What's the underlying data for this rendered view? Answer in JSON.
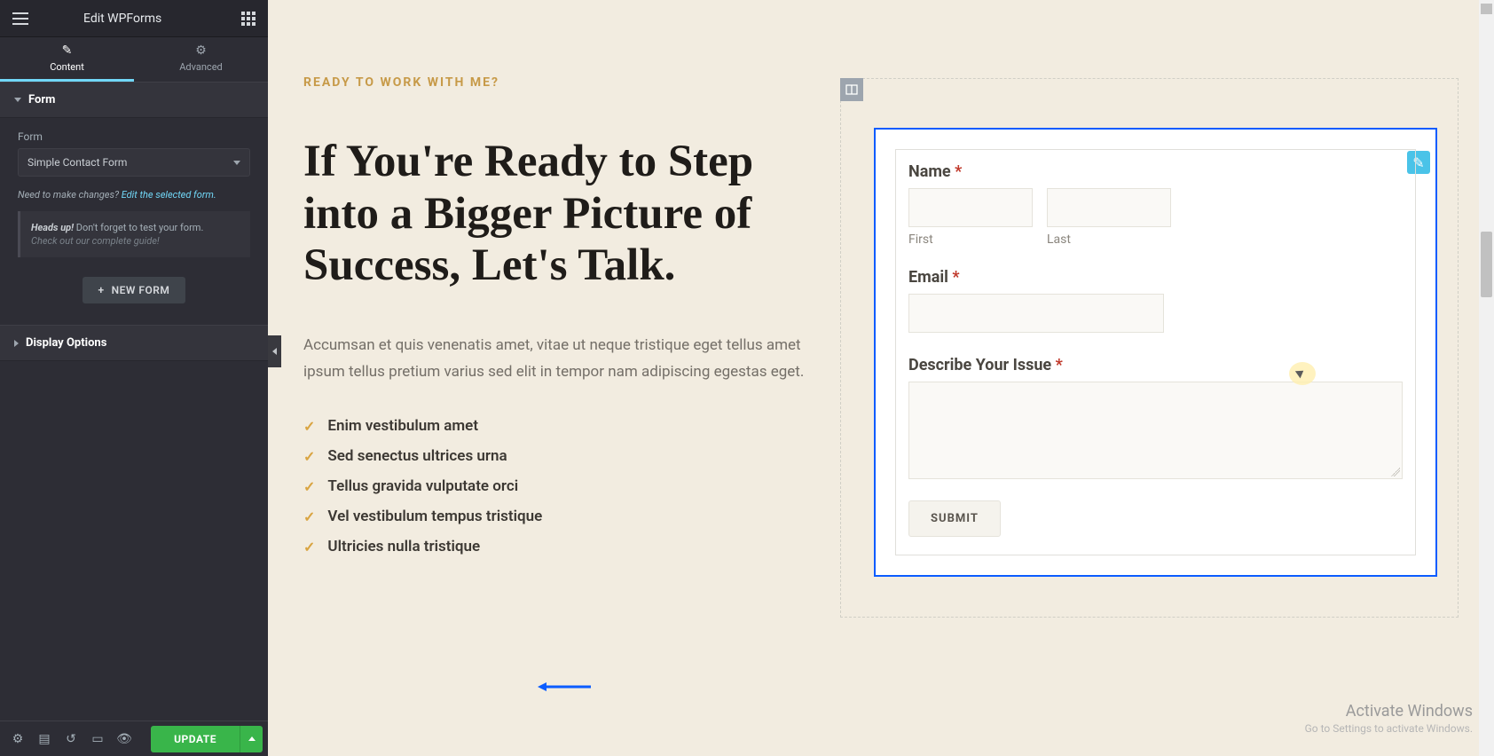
{
  "panel": {
    "title": "Edit WPForms",
    "tabs": {
      "content": "Content",
      "advanced": "Advanced"
    },
    "section_form_label": "Form",
    "form_field_label": "Form",
    "form_select_value": "Simple Contact Form",
    "hint_prefix": "Need to make changes? ",
    "hint_link": "Edit the selected form.",
    "heads_up_strong": "Heads up!",
    "heads_up_rest": " Don't forget to test your form.",
    "heads_up_sub": "Check out our complete guide!",
    "new_form_label": "NEW FORM",
    "section_display_label": "Display Options",
    "update_label": "UPDATE"
  },
  "page": {
    "eyebrow": "READY TO WORK WITH ME?",
    "heading": "If You're Ready to Step into a Bigger Picture of Success, Let's Talk.",
    "paragraph": "Accumsan et quis venenatis amet, vitae ut neque tristique eget tellus amet ipsum tellus pretium varius sed elit in tempor nam adipiscing egestas eget.",
    "list": [
      "Enim vestibulum amet",
      "Sed senectus ultrices urna",
      "Tellus gravida vulputate orci",
      "Vel vestibulum tempus tristique",
      "Ultricies nulla tristique"
    ]
  },
  "form": {
    "name_label": "Name ",
    "first_label": "First",
    "last_label": "Last",
    "email_label": "Email ",
    "describe_label": "Describe Your Issue ",
    "submit_label": "SUBMIT"
  },
  "os": {
    "activate_title": "Activate Windows",
    "activate_sub": "Go to Settings to activate Windows."
  }
}
